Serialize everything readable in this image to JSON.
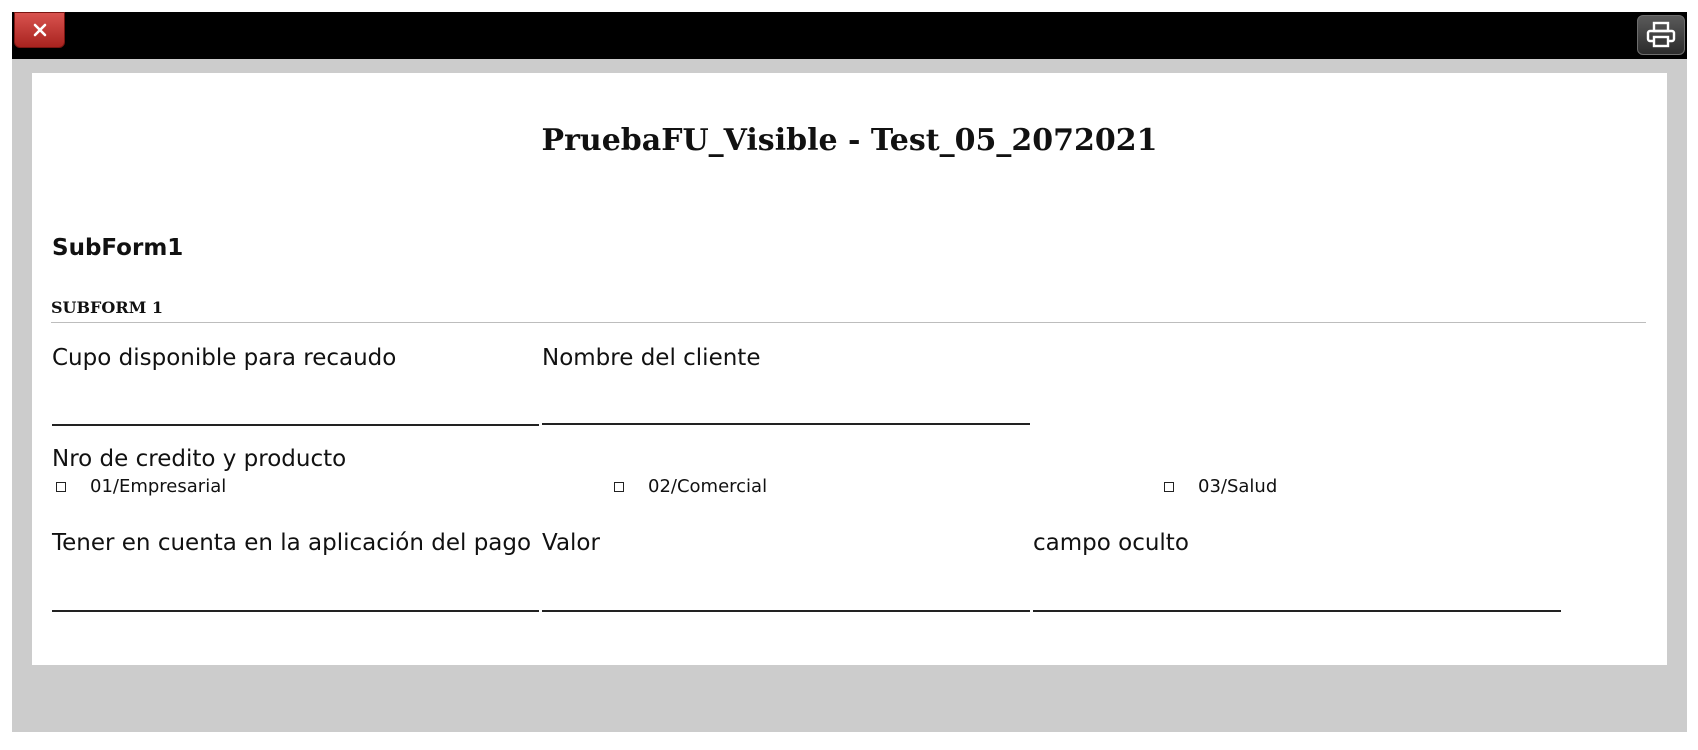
{
  "toolbar": {
    "close_icon": "close-icon",
    "print_icon": "printer-icon"
  },
  "form": {
    "title": "PruebaFU_Visible - Test_05_2072021",
    "subform_heading": "SubForm1",
    "section_title": "SUBFORM 1"
  },
  "fields": {
    "cupo_label": "Cupo disponible para recaudo",
    "cupo_value": "",
    "nombre_label": "Nombre del cliente",
    "nombre_value": "",
    "credito_label": "Nro de credito y producto",
    "credito_options": [
      "01/Empresarial",
      "02/Comercial",
      "03/Salud"
    ],
    "tener_label": "Tener en cuenta en la aplicación del pago",
    "tener_value": "",
    "valor_label": "Valor",
    "valor_value": "",
    "oculto_label": "campo oculto",
    "oculto_value": ""
  },
  "colors": {
    "close_button": "#c9302c",
    "toolbar": "#000000",
    "frame_background": "#cccccc",
    "page_background": "#ffffff"
  }
}
